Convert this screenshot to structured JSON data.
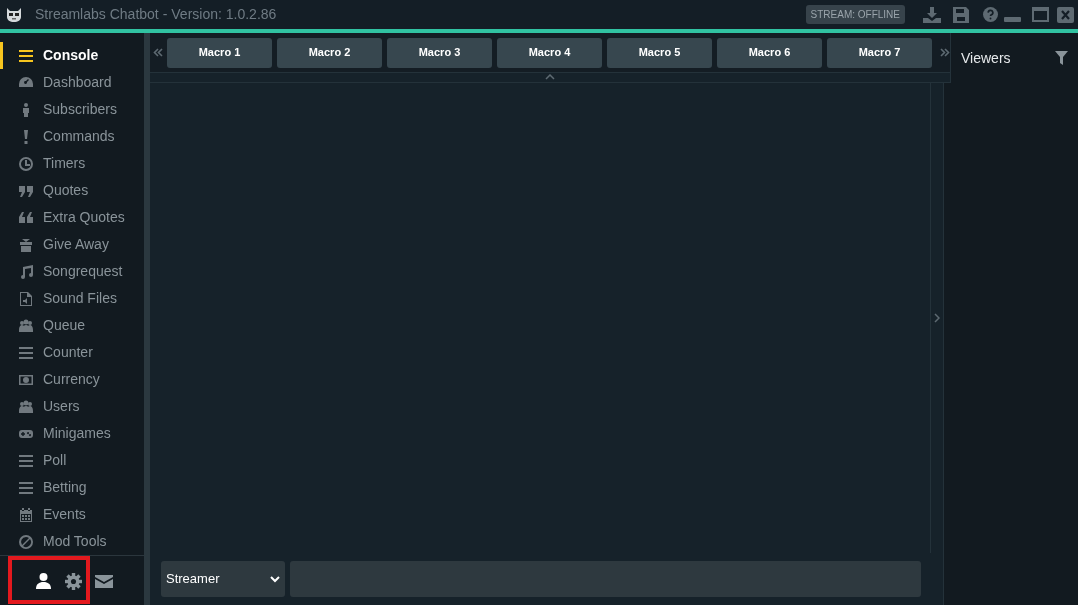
{
  "window": {
    "title": "Streamlabs Chatbot",
    "version": "- Version: 1.0.2.86",
    "stream_status": "STREAM: OFFLINE"
  },
  "sidebar": {
    "items": [
      {
        "label": "Console",
        "selected": true
      },
      {
        "label": "Dashboard",
        "selected": false
      },
      {
        "label": "Subscribers",
        "selected": false
      },
      {
        "label": "Commands",
        "selected": false
      },
      {
        "label": "Timers",
        "selected": false
      },
      {
        "label": "Quotes",
        "selected": false
      },
      {
        "label": "Extra Quotes",
        "selected": false
      },
      {
        "label": "Give Away",
        "selected": false
      },
      {
        "label": "Songrequest",
        "selected": false
      },
      {
        "label": "Sound Files",
        "selected": false
      },
      {
        "label": "Queue",
        "selected": false
      },
      {
        "label": "Counter",
        "selected": false
      },
      {
        "label": "Currency",
        "selected": false
      },
      {
        "label": "Users",
        "selected": false
      },
      {
        "label": "Minigames",
        "selected": false
      },
      {
        "label": "Poll",
        "selected": false
      },
      {
        "label": "Betting",
        "selected": false
      },
      {
        "label": "Events",
        "selected": false
      },
      {
        "label": "Mod Tools",
        "selected": false
      }
    ]
  },
  "macros": [
    "Macro 1",
    "Macro 2",
    "Macro 3",
    "Macro 4",
    "Macro 5",
    "Macro 6",
    "Macro 7"
  ],
  "viewers": {
    "title": "Viewers"
  },
  "chat": {
    "role": "Streamer"
  }
}
